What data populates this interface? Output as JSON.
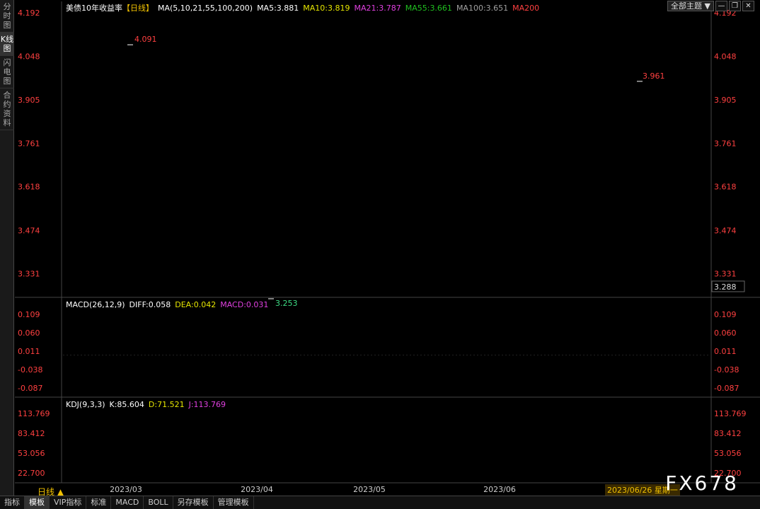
{
  "left_tabs": [
    {
      "label": "分时图"
    },
    {
      "label": "K线图"
    },
    {
      "label": "闪电图"
    },
    {
      "label": "合约资料"
    }
  ],
  "legend_main": {
    "title": "美债10年收益率",
    "period": "【日线】",
    "ma_params": "MA(5,10,21,55,100,200)",
    "ma5": "MA5:3.881",
    "ma10": "MA10:3.819",
    "ma21": "MA21:3.787",
    "ma55": "MA55:3.661",
    "ma100": "MA100:3.651",
    "ma200": "MA200"
  },
  "theme_button": "全部主题",
  "legend_macd": {
    "title": "MACD(26,12,9)",
    "diff": "DIFF:0.058",
    "dea": "DEA:0.042",
    "macd": "MACD:0.031"
  },
  "legend_kdj": {
    "title": "KDJ(9,3,3)",
    "k": "K:85.604",
    "d": "D:71.521",
    "j": "J:113.769"
  },
  "price_axis": [
    "4.192",
    "4.048",
    "3.905",
    "3.761",
    "3.618",
    "3.474",
    "3.331"
  ],
  "price_axis_extra": "3.288",
  "macd_axis": [
    "0.109",
    "0.060",
    "0.011",
    "-0.038",
    "-0.087"
  ],
  "kdj_axis": [
    "113.769",
    "83.412",
    "53.056",
    "22.700"
  ],
  "x_axis": [
    "2023/03",
    "2023/04",
    "2023/05",
    "2023/06"
  ],
  "annotations": {
    "high": "4.091",
    "low": "3.253",
    "last": "3.961"
  },
  "period_label": "日线 ▲",
  "date_cursor": "2023/06/26 星期一",
  "brand": "FX678",
  "bottom_tabs": [
    "指标",
    "模板",
    "VIP指标",
    "标准",
    "MACD",
    "BOLL",
    "另存模板",
    "管理模板"
  ],
  "colors": {
    "up": "#ff3b3b",
    "down": "#3ddc84",
    "ma5": "#ffffff",
    "ma10": "#e6e600",
    "ma21": "#e040e0",
    "ma55": "#20c020",
    "ma100": "#a0a0a0",
    "ma200": "#ff4040"
  },
  "chart_data": {
    "type": "candlestick",
    "title": "美债10年收益率",
    "x_ticks": [
      "2023/03",
      "2023/04",
      "2023/05",
      "2023/06"
    ],
    "y_ticks": [
      4.192,
      4.048,
      3.905,
      3.761,
      3.618,
      3.474,
      3.331
    ],
    "ylim": [
      3.253,
      4.192
    ],
    "annotated_high": 4.091,
    "annotated_low": 3.253,
    "annotated_last": 3.961,
    "macd_ticks": [
      0.109,
      0.06,
      0.011,
      -0.038,
      -0.087
    ],
    "kdj_ticks": [
      113.769,
      83.412,
      53.056,
      22.7
    ],
    "indicators": {
      "MA5": 3.881,
      "MA10": 3.819,
      "MA21": 3.787,
      "MA55": 3.661,
      "MA100": 3.651,
      "DIFF": 0.058,
      "DEA": 0.042,
      "MACD": 0.031,
      "K": 85.604,
      "D": 71.521,
      "J": 113.769
    }
  }
}
